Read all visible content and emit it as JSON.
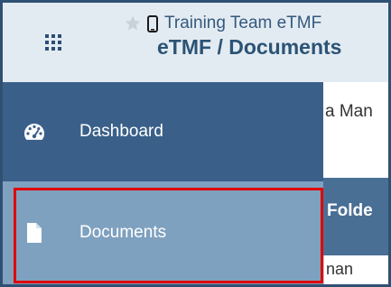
{
  "header": {
    "app_menu_icon": "grid-icon",
    "favorite_icon": "star-icon",
    "device_icon": "phone-icon",
    "study_name": "Training Team eTMF",
    "page_title": "eTMF / Documents"
  },
  "sidebar": {
    "items": [
      {
        "label": "Dashboard",
        "icon": "dashboard-gauge-icon",
        "selected": false
      },
      {
        "label": "Documents",
        "icon": "document-icon",
        "selected": true
      }
    ]
  },
  "content_peek": {
    "row1_text": "a Man",
    "column_header": "Folde",
    "row2_text": "nan"
  },
  "colors": {
    "outer_border": "#2f5072",
    "topbar_bg": "#e3ebf2",
    "nav_dashboard_bg": "#3a6089",
    "nav_documents_bg": "#7fa1c0",
    "column_header_bg": "#4a6f95",
    "highlight": "#e00000"
  }
}
